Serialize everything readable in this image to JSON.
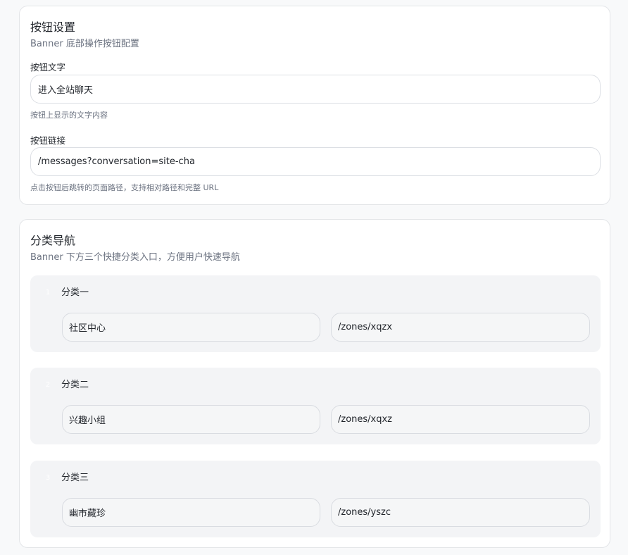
{
  "button_settings": {
    "title": "按钮设置",
    "subtitle": "Banner 底部操作按钮配置",
    "text_field": {
      "label": "按钮文字",
      "value": "进入全站聊天",
      "help": "按钮上显示的文字内容"
    },
    "link_field": {
      "label": "按钮链接",
      "value": "/messages?conversation=site-cha",
      "help": "点击按钮后跳转的页面路径，支持相对路径和完整 URL"
    }
  },
  "category_nav": {
    "title": "分类导航",
    "subtitle": "Banner 下方三个快捷分类入口，方便用户快速导航",
    "categories": [
      {
        "index": "1",
        "title": "分类一",
        "name": "社区中心",
        "link": "/zones/xqzx"
      },
      {
        "index": "2",
        "title": "分类二",
        "name": "兴趣小组",
        "link": "/zones/xqxz"
      },
      {
        "index": "3",
        "title": "分类三",
        "name": "幽市藏珍",
        "link": "/zones/yszc"
      }
    ]
  }
}
